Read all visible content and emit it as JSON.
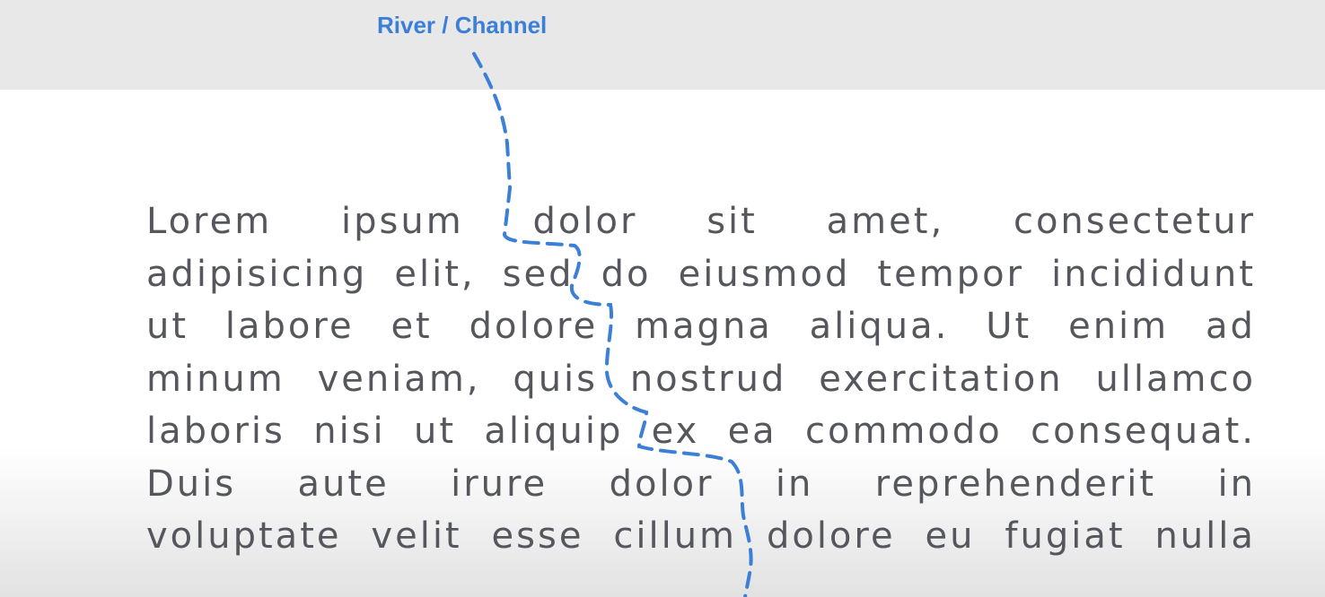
{
  "annotation": {
    "label": "River / Channel",
    "color": "#3b7fd6"
  },
  "paragraph": {
    "lines": [
      [
        "Lorem",
        "ipsum",
        "dolor",
        "sit",
        "amet,",
        "consectetur"
      ],
      [
        "adipisicing",
        "elit,",
        "sed",
        "do",
        "eiusmod",
        "tempor",
        "incididunt"
      ],
      [
        "ut",
        "labore",
        "et",
        "dolore",
        "magna",
        "aliqua.",
        "Ut",
        "enim",
        "ad"
      ],
      [
        "minum",
        "veniam,",
        "quis",
        "nostrud",
        "exercitation",
        "ullamco"
      ],
      [
        "laboris",
        "nisi",
        "ut",
        "aliquip",
        "ex",
        "ea",
        "commodo",
        "consequat."
      ],
      [
        "Duis",
        "aute",
        "irure",
        "dolor",
        "in",
        "reprehenderit",
        "in"
      ],
      [
        "voluptate",
        "velit",
        "esse",
        "cillum",
        "dolore",
        "eu",
        "fugiat",
        "nulla"
      ]
    ],
    "text_color": "#55575c"
  },
  "background": {
    "top_band": "#e8e8e8",
    "page": "#ffffff"
  }
}
